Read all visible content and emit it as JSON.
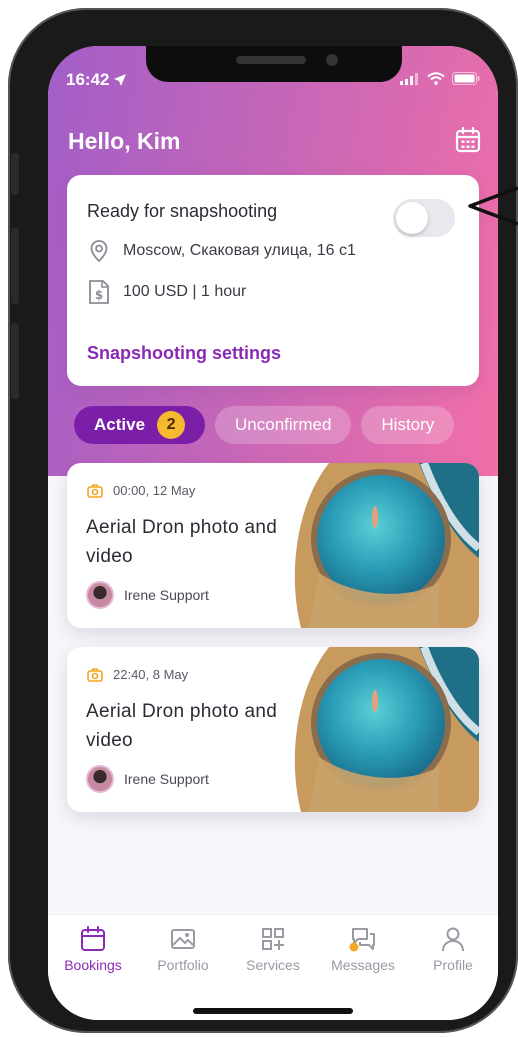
{
  "status_bar": {
    "time": "16:42"
  },
  "header": {
    "greeting": "Hello, Kim"
  },
  "snapshot_card": {
    "title": "Ready for snapshooting",
    "toggle_on": false,
    "location": "Moscow, Скаковая улица, 16 с1",
    "price": "100 USD | 1 hour",
    "settings_link": "Snapshooting settings"
  },
  "tabs": [
    {
      "label": "Active",
      "count": "2",
      "active": true
    },
    {
      "label": "Unconfirmed",
      "active": false
    },
    {
      "label": "History",
      "active": false
    }
  ],
  "bookings": [
    {
      "datetime": "00:00, 12 May",
      "title": "Aerial Dron photo and video",
      "user": "Irene Support"
    },
    {
      "datetime": "22:40, 8 May",
      "title": "Aerial Dron photo and video",
      "user": "Irene Support"
    }
  ],
  "bottom_nav": [
    {
      "label": "Bookings",
      "icon": "calendar-icon",
      "active": true
    },
    {
      "label": "Portfolio",
      "icon": "image-icon",
      "active": false
    },
    {
      "label": "Services",
      "icon": "grid-plus-icon",
      "active": false
    },
    {
      "label": "Messages",
      "icon": "chat-icon",
      "active": false,
      "has_notification": true
    },
    {
      "label": "Profile",
      "icon": "user-icon",
      "active": false
    }
  ],
  "colors": {
    "accent": "#8a2bb5",
    "active_tab": "#7c1fa8",
    "badge": "#f5b82e",
    "gradient_start": "#a25ec8",
    "gradient_end": "#f26fa8"
  }
}
